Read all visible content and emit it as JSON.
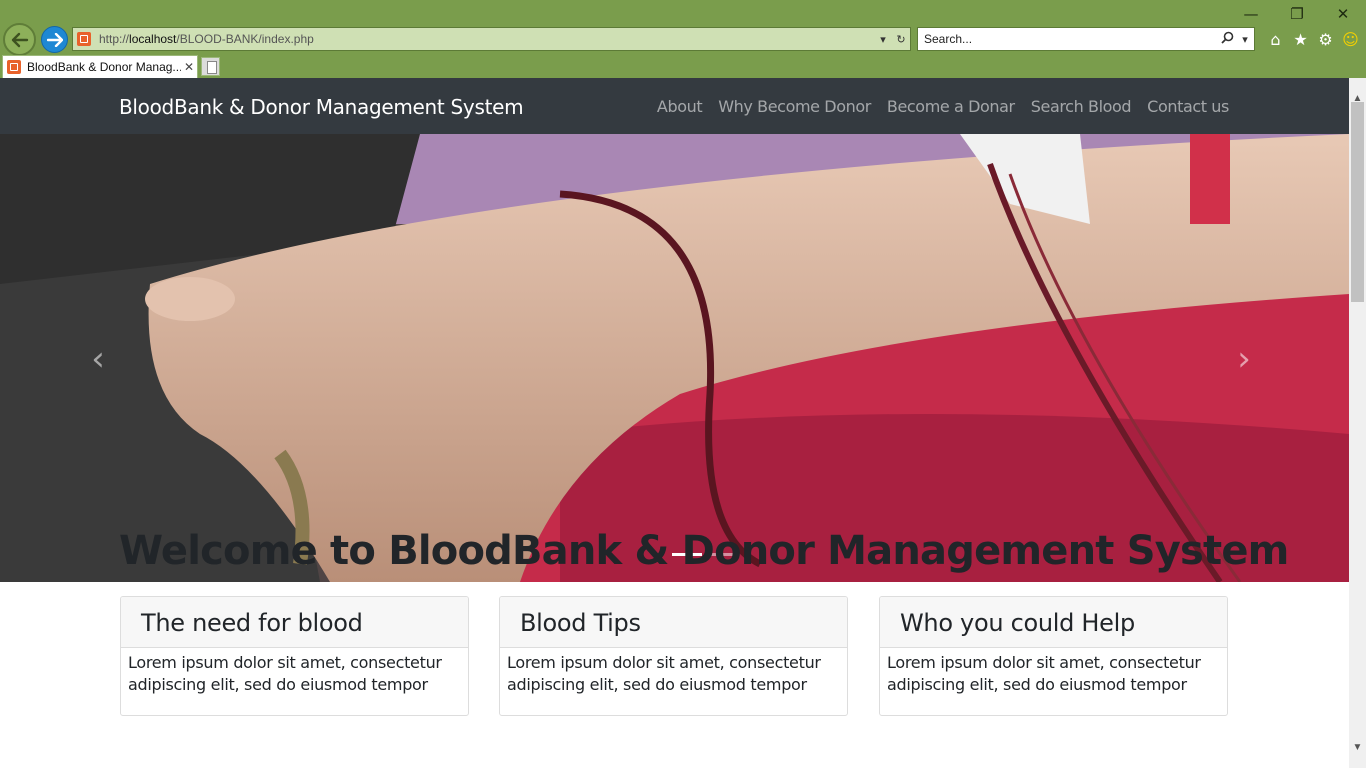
{
  "browser": {
    "address_prefix": "http://",
    "address_host": "localhost",
    "address_path": "/BLOOD-BANK/index.php",
    "search_placeholder": "Search...",
    "tab_title": "BloodBank & Donor Manag...",
    "icons": [
      "back-arrow-icon",
      "forward-arrow-icon",
      "refresh-icon",
      "search-icon",
      "home-icon",
      "favorites-star-icon",
      "settings-gear-icon",
      "smiley-feedback-icon"
    ],
    "chrome_color": "#7a9d4c"
  },
  "navbar": {
    "brand": "BloodBank & Donor Management System",
    "links": [
      "About",
      "Why Become Donor",
      "Become a Donar",
      "Search Blood",
      "Contact us"
    ],
    "bg_color": "#343a40"
  },
  "carousel": {
    "prev_icon": "chevron-left-icon",
    "next_icon": "chevron-right-icon",
    "slide_count": 2,
    "active_slide": 1
  },
  "main": {
    "heading": "Welcome to BloodBank & Donor Management System",
    "cards": [
      {
        "title": "The need for blood",
        "body": "Lorem ipsum dolor sit amet, consectetur adipiscing elit, sed do eiusmod tempor"
      },
      {
        "title": "Blood Tips",
        "body": "Lorem ipsum dolor sit amet, consectetur adipiscing elit, sed do eiusmod tempor"
      },
      {
        "title": "Who you could Help",
        "body": "Lorem ipsum dolor sit amet, consectetur adipiscing elit, sed do eiusmod tempor"
      }
    ]
  }
}
